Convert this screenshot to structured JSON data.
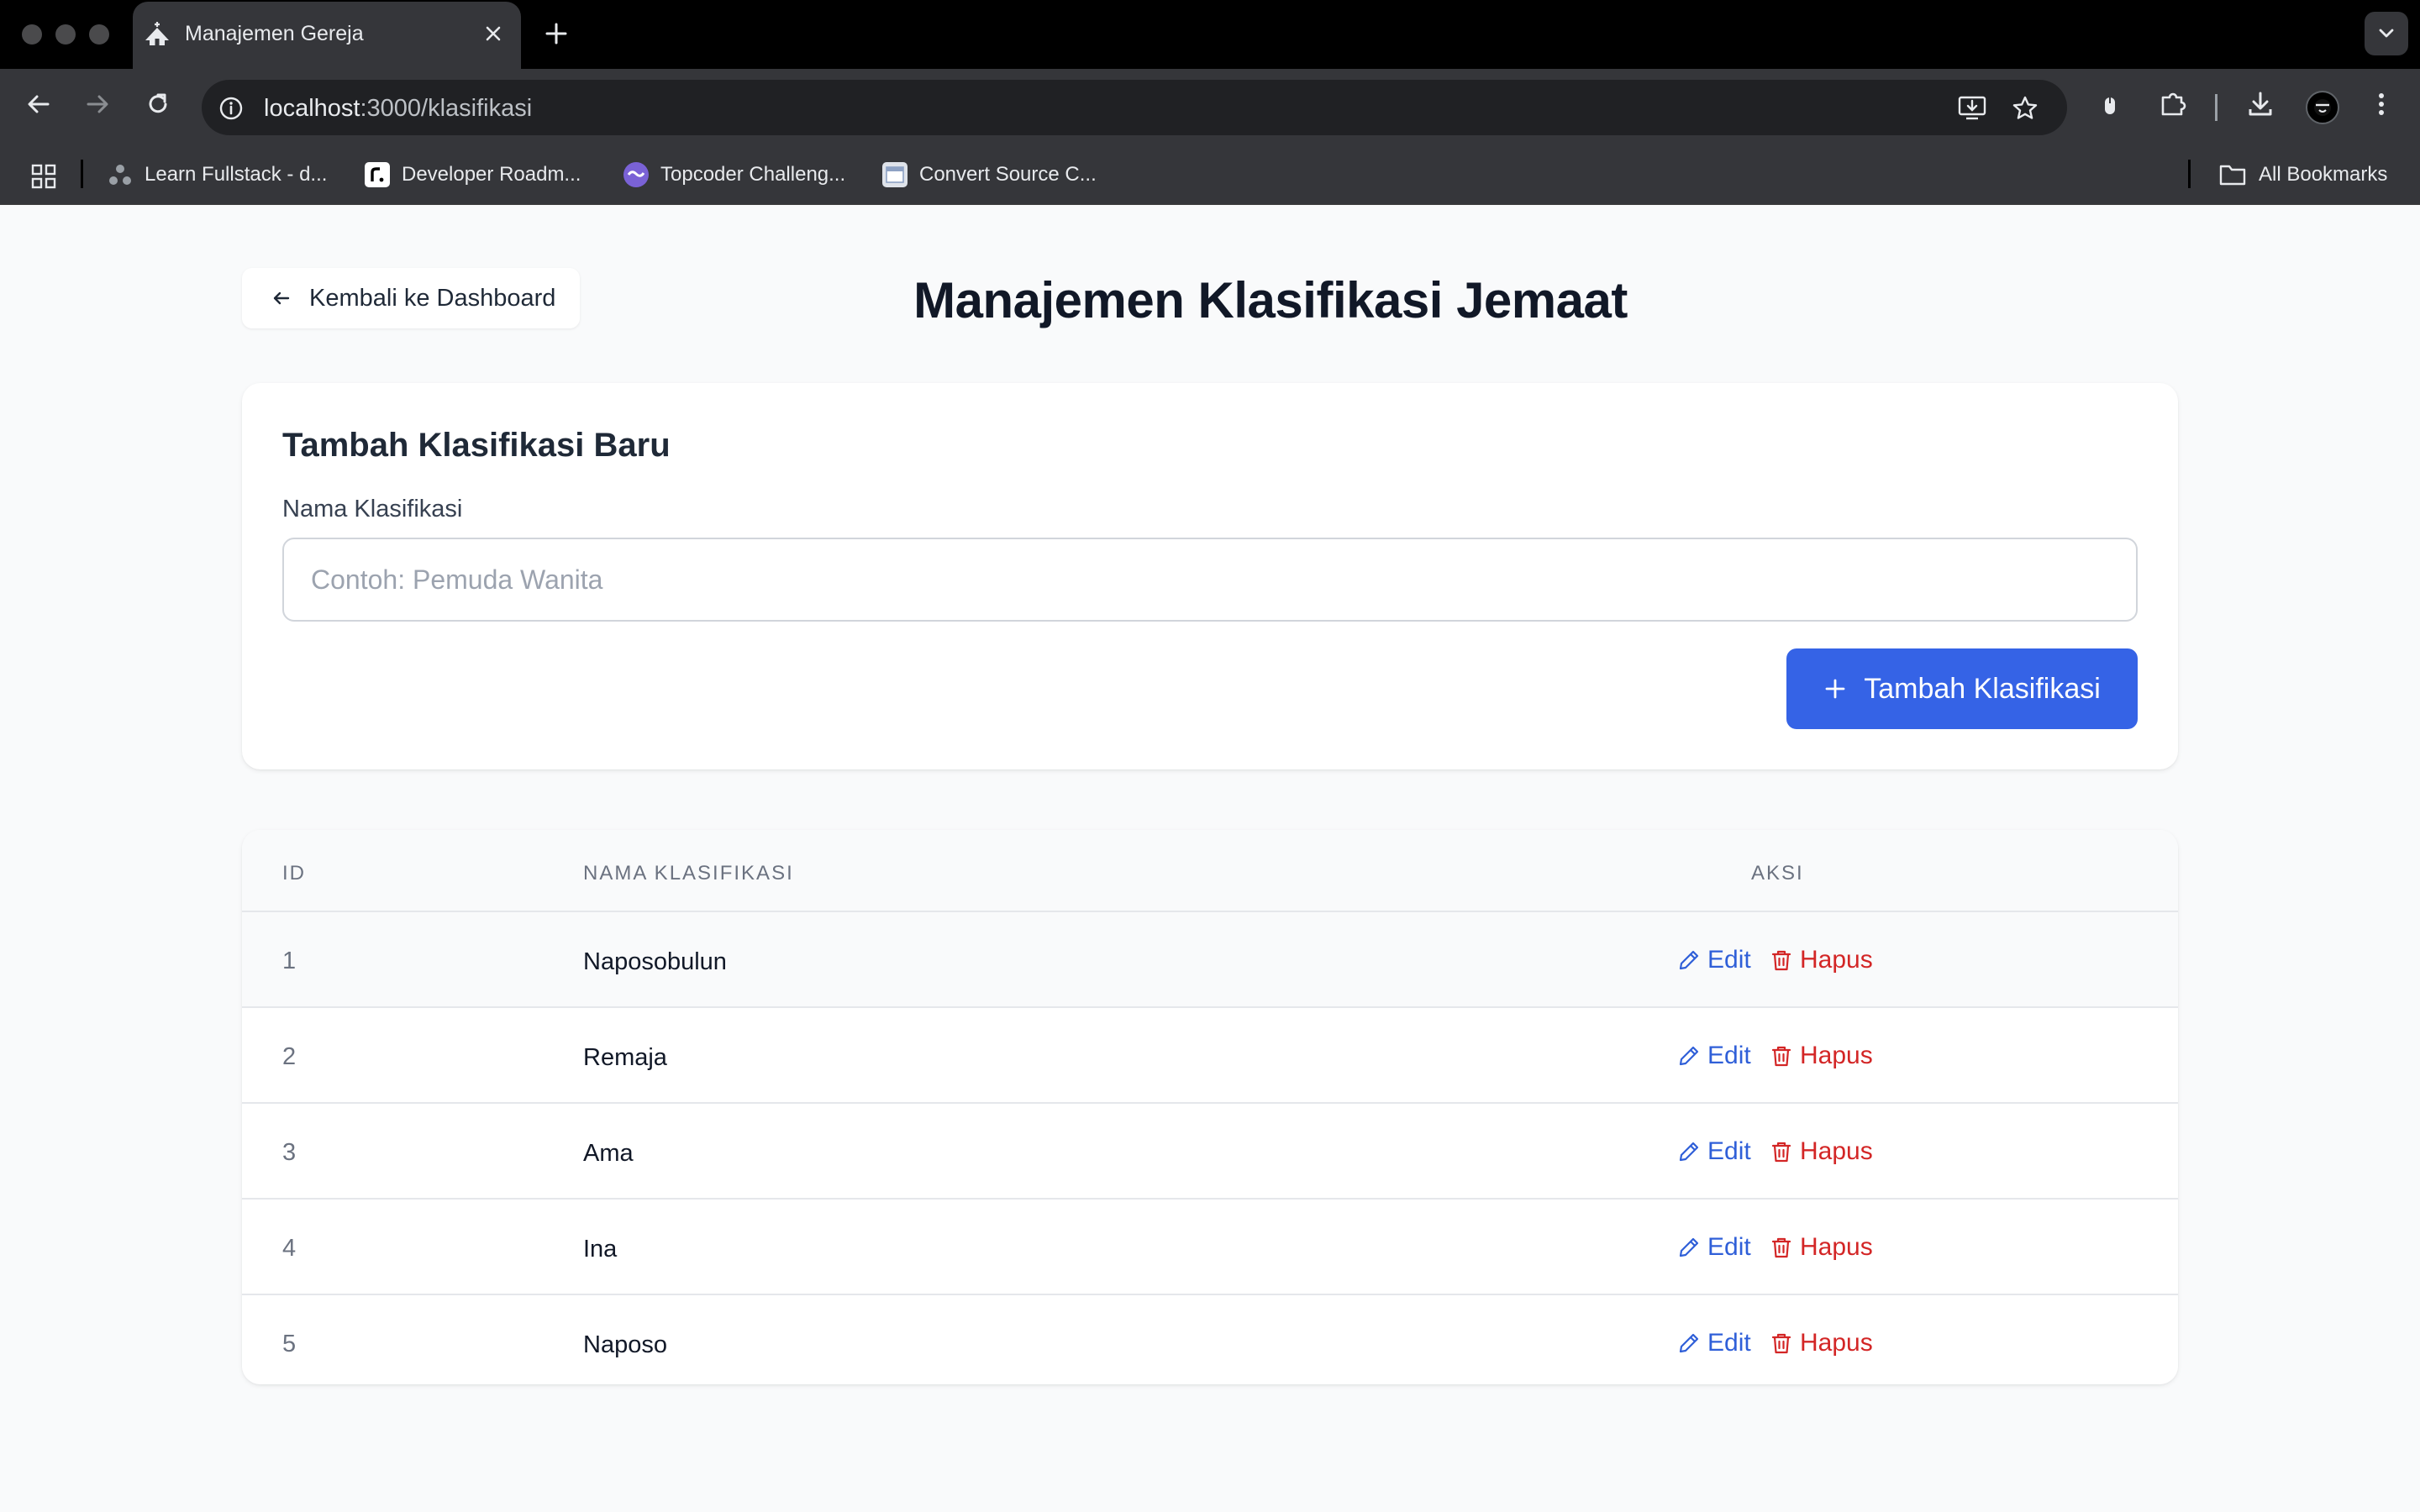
{
  "browser": {
    "tab_title": "Manajemen Gereja",
    "url_host": "localhost",
    "url_rest": ":3000/klasifikasi",
    "bookmarks": [
      {
        "label": "Learn Fullstack - d..."
      },
      {
        "label": "Developer Roadm..."
      },
      {
        "label": "Topcoder Challeng..."
      },
      {
        "label": "Convert Source C..."
      }
    ],
    "all_bookmarks_label": "All Bookmarks"
  },
  "header": {
    "back_label": "Kembali ke Dashboard",
    "title": "Manajemen Klasifikasi Jemaat"
  },
  "form": {
    "title": "Tambah Klasifikasi Baru",
    "field_label": "Nama Klasifikasi",
    "placeholder": "Contoh: Pemuda Wanita",
    "value": "",
    "submit_label": "Tambah Klasifikasi"
  },
  "table": {
    "headers": {
      "id": "ID",
      "name": "NAMA KLASIFIKASI",
      "actions": "AKSI"
    },
    "rows": [
      {
        "id": "1",
        "name": "Naposobulun"
      },
      {
        "id": "2",
        "name": "Remaja"
      },
      {
        "id": "3",
        "name": "Ama"
      },
      {
        "id": "4",
        "name": "Ina"
      },
      {
        "id": "5",
        "name": "Naposo"
      }
    ],
    "edit_label": "Edit",
    "delete_label": "Hapus"
  },
  "colors": {
    "primary": "#3563e6",
    "edit": "#2f5fd8",
    "delete": "#d32626",
    "title": "#111827"
  }
}
